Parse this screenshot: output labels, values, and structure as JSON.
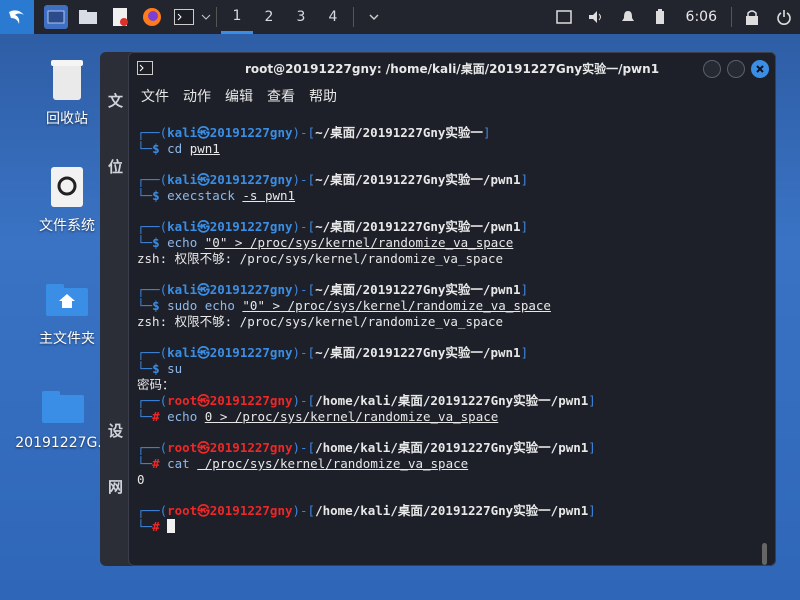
{
  "taskbar": {
    "workspaces": [
      "1",
      "2",
      "3",
      "4"
    ],
    "clock": "6:06"
  },
  "desktop": {
    "icons": [
      {
        "label": "回收站"
      },
      {
        "label": "文件系统"
      },
      {
        "label": "主文件夹"
      },
      {
        "label": "20191227G..."
      }
    ]
  },
  "filemanager": {
    "side_labels": [
      "文",
      "位",
      "设",
      "网"
    ]
  },
  "terminal": {
    "title": "root@20191227gny: /home/kali/桌面/20191227Gny实验一/pwn1",
    "menu": [
      "文件",
      "动作",
      "编辑",
      "查看",
      "帮助"
    ],
    "blocks": [
      {
        "user": "kali",
        "host": "20191227gny",
        "path": "~/桌面/20191227Gny实验一",
        "prompt": "$",
        "cmd": "cd",
        "args": "pwn1",
        "output": []
      },
      {
        "user": "kali",
        "host": "20191227gny",
        "path": "~/桌面/20191227Gny实验一/pwn1",
        "prompt": "$",
        "cmd": "execstack",
        "args": "-s pwn1",
        "output": []
      },
      {
        "user": "kali",
        "host": "20191227gny",
        "path": "~/桌面/20191227Gny实验一/pwn1",
        "prompt": "$",
        "cmd": "echo",
        "args": "\"0\" > /proc/sys/kernel/randomize_va_space",
        "output": [
          "zsh: 权限不够: /proc/sys/kernel/randomize_va_space"
        ]
      },
      {
        "user": "kali",
        "host": "20191227gny",
        "path": "~/桌面/20191227Gny实验一/pwn1",
        "prompt": "$",
        "cmd": "sudo echo",
        "args": "\"0\" > /proc/sys/kernel/randomize_va_space",
        "output": [
          "zsh: 权限不够: /proc/sys/kernel/randomize_va_space"
        ]
      },
      {
        "user": "kali",
        "host": "20191227gny",
        "path": "~/桌面/20191227Gny实验一/pwn1",
        "prompt": "$",
        "cmd": "su",
        "args": "",
        "output": [
          "密码："
        ]
      },
      {
        "user": "root",
        "host": "20191227gny",
        "path": "/home/kali/桌面/20191227Gny实验一/pwn1",
        "prompt": "#",
        "cmd": "echo",
        "args": "0 > /proc/sys/kernel/randomize_va_space",
        "output": []
      },
      {
        "user": "root",
        "host": "20191227gny",
        "path": "/home/kali/桌面/20191227Gny实验一/pwn1",
        "prompt": "#",
        "cmd": "cat",
        "args": " /proc/sys/kernel/randomize_va_space",
        "output": [
          "0"
        ]
      },
      {
        "user": "root",
        "host": "20191227gny",
        "path": "/home/kali/桌面/20191227Gny实验一/pwn1",
        "prompt": "#",
        "cmd": "",
        "args": "",
        "output": []
      }
    ]
  }
}
